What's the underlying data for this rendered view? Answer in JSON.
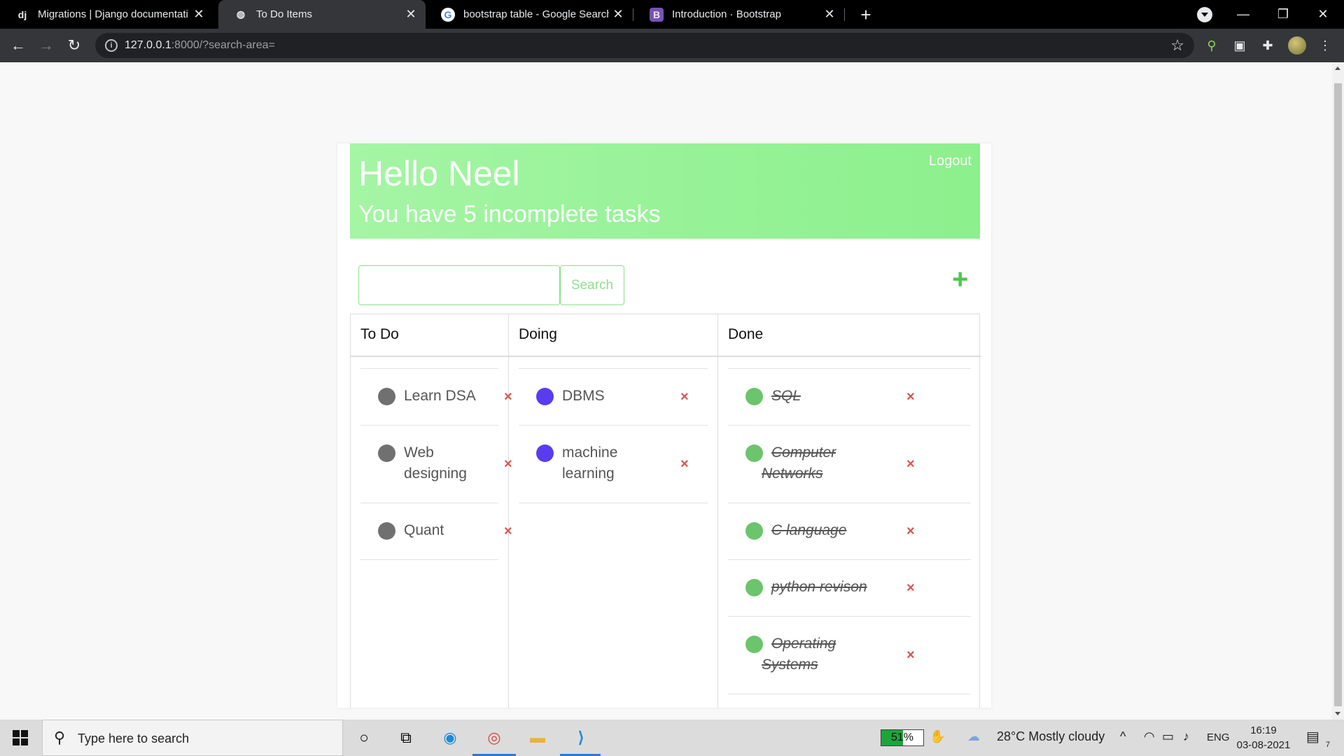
{
  "browser": {
    "tabs": [
      {
        "label": "Migrations | Django documentati",
        "icon": "django-icon",
        "favicon_text": "dj"
      },
      {
        "label": "To Do Items",
        "icon": "globe-icon",
        "favicon_text": "◍"
      },
      {
        "label": "bootstrap table - Google Search",
        "icon": "google-icon",
        "favicon_text": "G"
      },
      {
        "label": "Introduction · Bootstrap",
        "icon": "bootstrap-icon",
        "favicon_text": "B"
      }
    ],
    "active_tab": 1,
    "url_host": "127.0.0.1",
    "url_rest": ":8000/?search-area="
  },
  "page": {
    "greeting": "Hello Neel",
    "subtitle": "You have 5 incomplete tasks",
    "logout_label": "Logout",
    "search": {
      "value": "",
      "button_label": "Search"
    },
    "add_label": "+",
    "columns": [
      {
        "title": "To Do",
        "status_color": "#707070",
        "items": [
          {
            "lines": [
              "Learn DSA"
            ],
            "done": false
          },
          {
            "lines": [
              "Web",
              "designing"
            ],
            "done": false
          },
          {
            "lines": [
              "Quant"
            ],
            "done": false
          }
        ]
      },
      {
        "title": "Doing",
        "status_color": "#5a3cf0",
        "items": [
          {
            "lines": [
              "DBMS"
            ],
            "done": false
          },
          {
            "lines": [
              "machine",
              "learning"
            ],
            "done": false
          }
        ]
      },
      {
        "title": "Done",
        "status_color": "#6cc46c",
        "items": [
          {
            "lines": [
              "SQL"
            ],
            "done": true
          },
          {
            "lines": [
              "Computer",
              "Networks"
            ],
            "done": true
          },
          {
            "lines": [
              "C language"
            ],
            "done": true
          },
          {
            "lines": [
              "python revison"
            ],
            "done": true
          },
          {
            "lines": [
              "Operating",
              "Systems"
            ],
            "done": true
          }
        ]
      }
    ],
    "delete_glyph": "×"
  },
  "taskbar": {
    "search_placeholder": "Type here to search",
    "battery_percent": "51%",
    "battery_level": 0.51,
    "weather": "28°C  Mostly cloudy",
    "language": "ENG",
    "time": "16:19",
    "date": "03-08-2021",
    "notifications": "7"
  }
}
